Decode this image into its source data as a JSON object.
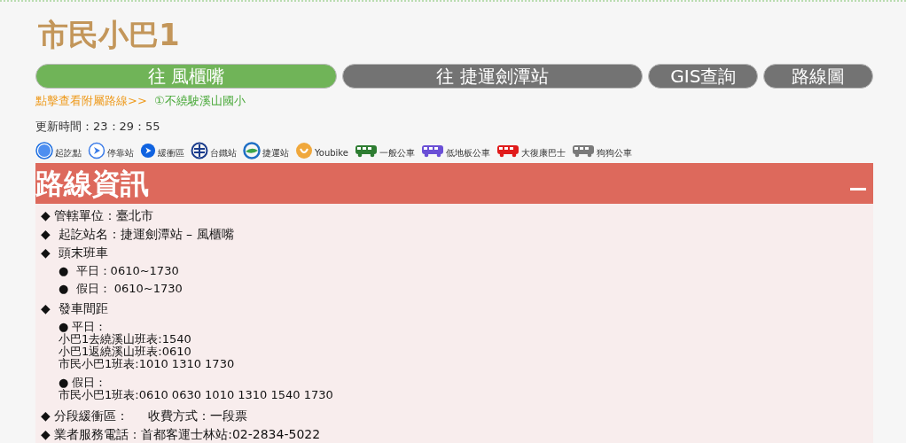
{
  "title": "市民小巴1",
  "tabs": [
    {
      "label": "往 風櫃嘴",
      "selected": true,
      "kind": "wide"
    },
    {
      "label": "往 捷運劍潭站",
      "selected": false,
      "kind": "wide"
    },
    {
      "label": "GIS查詢",
      "selected": false,
      "kind": "narrow"
    },
    {
      "label": "路線圖",
      "selected": false,
      "kind": "narrow"
    }
  ],
  "sub_route": {
    "prompt": "點擊查看附屬路線>>",
    "link": "①不繞駛溪山國小"
  },
  "updated": "更新時間：23：29：55",
  "legend": [
    {
      "label": "起訖點",
      "kind": "endpoint"
    },
    {
      "label": "停靠站",
      "kind": "stop"
    },
    {
      "label": "緩衝區",
      "kind": "buffer"
    },
    {
      "label": "台鐵站",
      "kind": "rail"
    },
    {
      "label": "捷運站",
      "kind": "metro"
    },
    {
      "label": "Youbike",
      "kind": "youbike"
    },
    {
      "label": "一般公車",
      "kind": "bus"
    },
    {
      "label": "低地板公車",
      "kind": "lowfloor"
    },
    {
      "label": "大復康巴士",
      "kind": "rehab"
    },
    {
      "label": "狗狗公車",
      "kind": "dog"
    }
  ],
  "section": {
    "title": "路線資訊",
    "expanded": true
  },
  "info": [
    {
      "kind": "main",
      "text": "◆ 管轄單位：臺北市"
    },
    {
      "kind": "main",
      "text": "◆  起訖站名：捷運劍潭站 – 風櫃嘴"
    },
    {
      "kind": "main",
      "text": "◆  頭末班車"
    },
    {
      "kind": "sub",
      "text": "●  平日：0610~1730"
    },
    {
      "kind": "sub",
      "text": "●  假日： 0610~1730"
    },
    {
      "kind": "main",
      "text": "◆  發車間距"
    },
    {
      "kind": "small",
      "text": "● 平日："
    },
    {
      "kind": "plain",
      "text": "小巴1去繞溪山班表:1540"
    },
    {
      "kind": "plain",
      "text": "小巴1返繞溪山班表:0610"
    },
    {
      "kind": "plain",
      "text": "市民小巴1班表:1010 1310 1730"
    },
    {
      "kind": "small",
      "text": "● 假日："
    },
    {
      "kind": "plain",
      "text": "市民小巴1班表:0610 0630 1010 1310 1540 1730"
    },
    {
      "kind": "main",
      "text": "◆ 分段緩衝區：     收費方式：一段票"
    },
    {
      "kind": "main",
      "text": "◆ 業者服務電話：首都客運士林站:02-2834-5022"
    }
  ]
}
